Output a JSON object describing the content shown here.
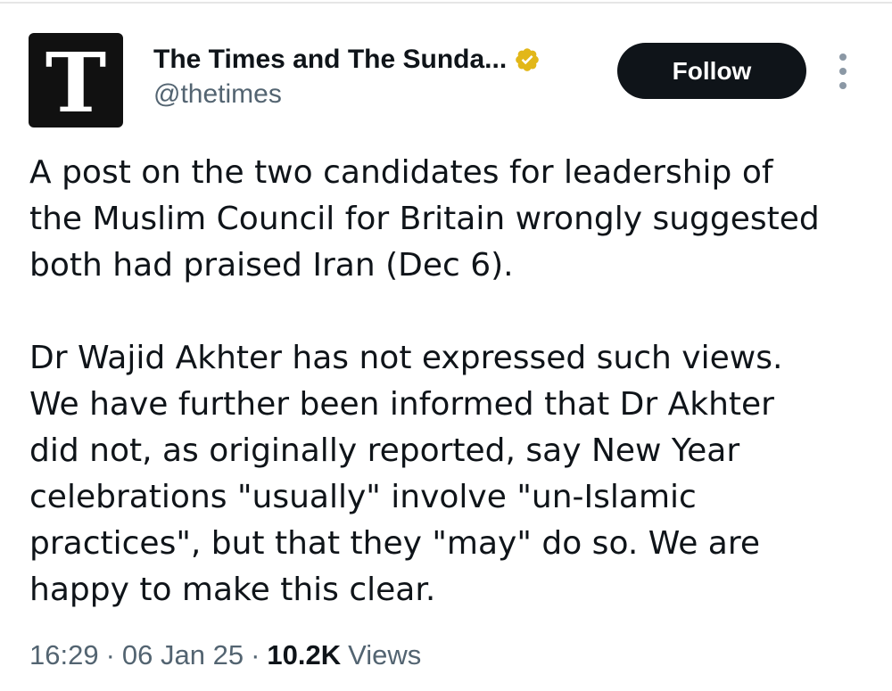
{
  "account": {
    "avatar_letter": "T",
    "display_name": "The Times and The Sunda...",
    "handle": "@thetimes",
    "verified_icon": "verified-badge-gold",
    "verified_color": "#e2b719"
  },
  "actions": {
    "follow_label": "Follow",
    "more_icon": "more-vertical-icon"
  },
  "tweet": {
    "paragraphs": [
      [
        "A post on the two candidates for leadership of",
        "the Muslim Council for Britain wrongly suggested",
        "both had praised Iran (Dec 6)."
      ],
      [
        "Dr Wajid Akhter has not expressed such views.",
        "We have further been informed that Dr Akhter",
        "did not, as originally reported, say New Year",
        "celebrations \"usually\" involve \"un-Islamic",
        "practices\", but that they \"may\" do so. We are",
        "happy to make this clear."
      ]
    ]
  },
  "meta": {
    "time": "16:29",
    "separator": "·",
    "date": "06 Jan 25",
    "views_count": "10.2K",
    "views_label": "Views"
  }
}
